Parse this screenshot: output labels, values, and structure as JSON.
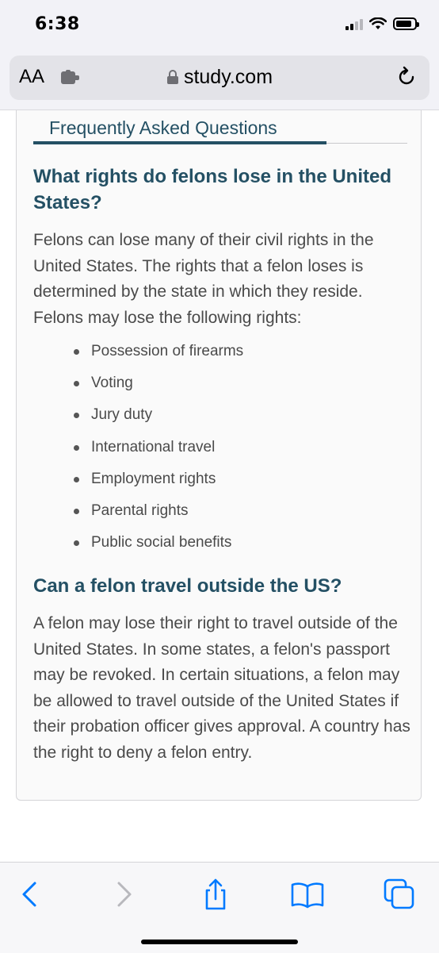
{
  "status_bar": {
    "time": "6:38"
  },
  "address_bar": {
    "text_size_label": "AA",
    "domain": "study.com"
  },
  "faq": {
    "heading": "Frequently Asked Questions",
    "q1": {
      "title": "What rights do felons lose in the United States?",
      "intro": "Felons can lose many of their civil rights in the United States. The rights that a felon loses is determined by the state in which they reside. Felons may lose the following rights:",
      "rights": [
        "Possession of firearms",
        "Voting",
        "Jury duty",
        "International travel",
        "Employment rights",
        "Parental rights",
        "Public social benefits"
      ]
    },
    "q2": {
      "title": "Can a felon travel outside the US?",
      "answer": "A felon may lose their right to travel outside of the United States. In some states, a felon's passport may be revoked. In certain situations, a felon may be allowed to travel outside of the United States if their probation officer gives approval. A country has the right to deny a felon entry."
    }
  },
  "colors": {
    "heading": "#245064",
    "body_text": "#4a4a4a",
    "accent": "#007aff",
    "banner": "#f0b94a"
  },
  "toolbar": {
    "icons": [
      "back-icon",
      "forward-icon",
      "share-icon",
      "bookmarks-icon",
      "tabs-icon"
    ]
  }
}
